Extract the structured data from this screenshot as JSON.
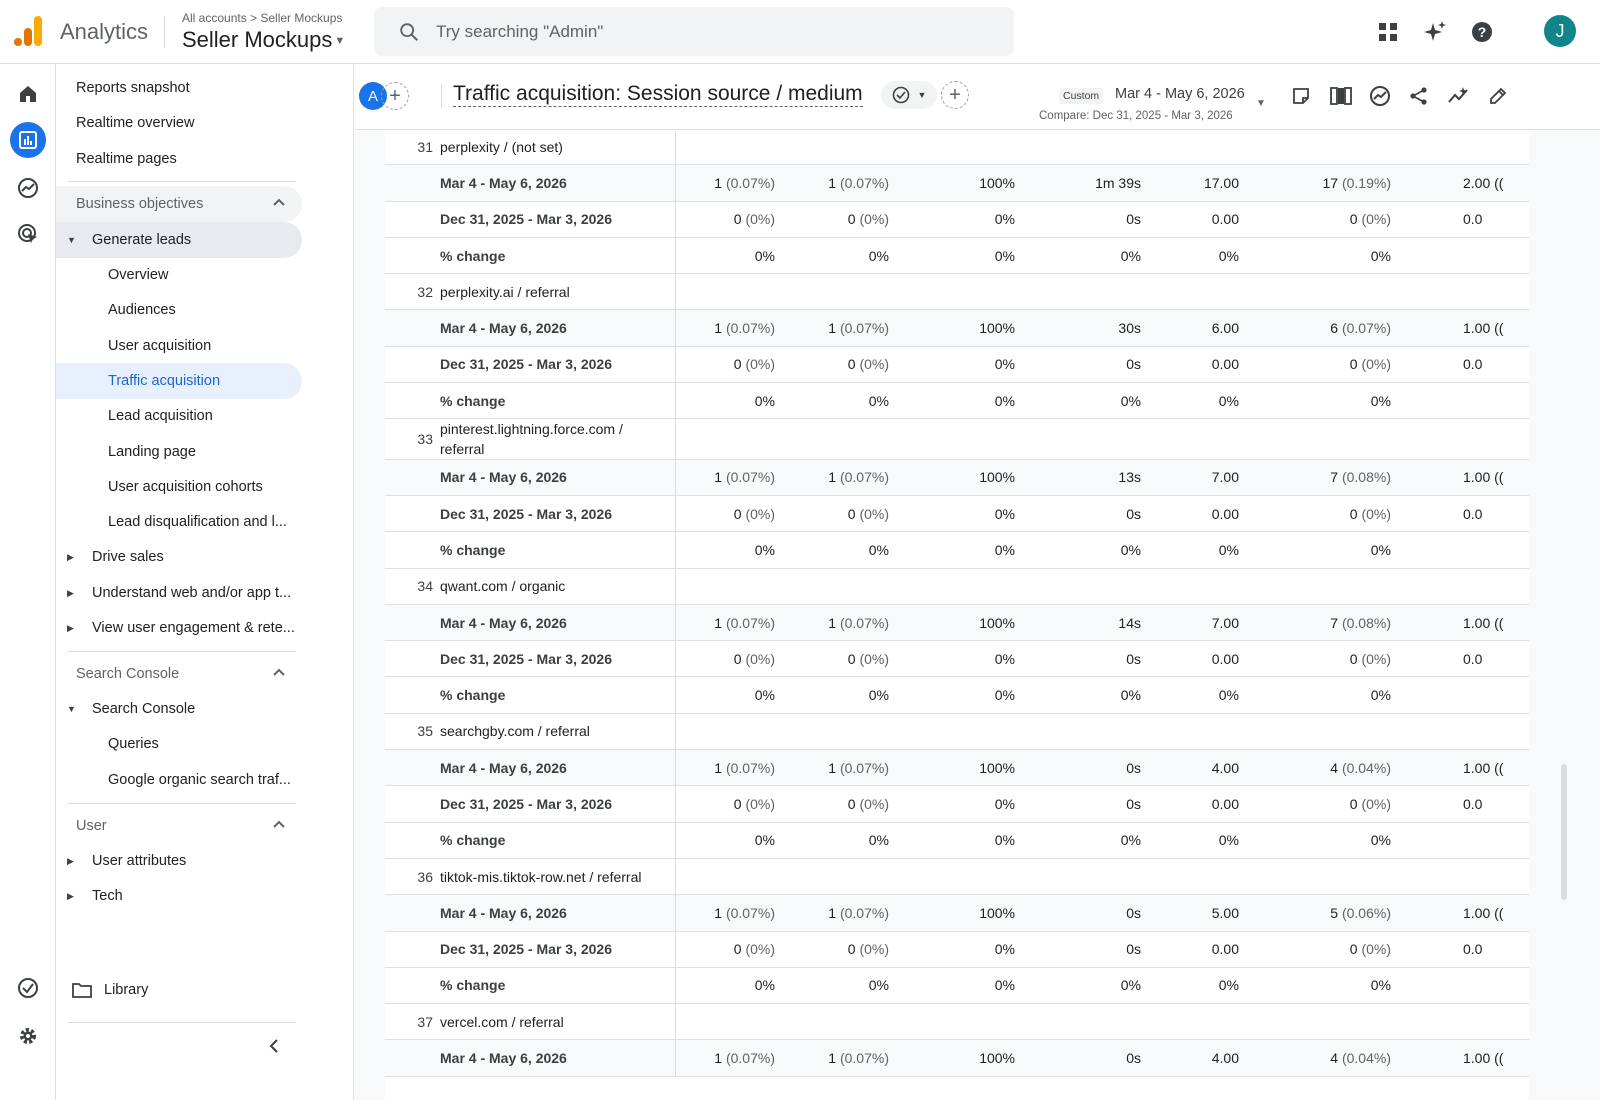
{
  "topbar": {
    "app_name": "Analytics",
    "breadcrumb": "All accounts > Seller Mockups",
    "property_name": "Seller Mockups",
    "search_placeholder": "Try searching \"Admin\"",
    "avatar_initial": "J",
    "icons": [
      "apps-grid-icon",
      "sparkle-icon",
      "help-icon"
    ]
  },
  "rail": {
    "items": [
      "home-icon",
      "reports-icon",
      "explore-icon",
      "advertising-icon"
    ],
    "bottom": [
      "check-circle-icon",
      "settings-icon"
    ]
  },
  "sidebar": {
    "reports_snapshot": "Reports snapshot",
    "realtime_overview": "Realtime overview",
    "realtime_pages": "Realtime pages",
    "business_objectives": "Business objectives",
    "generate_leads": "Generate leads",
    "overview": "Overview",
    "audiences": "Audiences",
    "user_acquisition": "User acquisition",
    "traffic_acquisition": "Traffic acquisition",
    "lead_acquisition": "Lead acquisition",
    "landing_page": "Landing page",
    "user_acquisition_cohorts": "User acquisition cohorts",
    "lead_disqualification": "Lead disqualification and l...",
    "drive_sales": "Drive sales",
    "understand_web": "Understand web and/or app t...",
    "view_user_engagement": "View user engagement & rete...",
    "search_console_section": "Search Console",
    "search_console": "Search Console",
    "queries": "Queries",
    "google_organic": "Google organic search traf...",
    "user_section": "User",
    "user_attributes": "User attributes",
    "tech": "Tech",
    "library": "Library"
  },
  "report": {
    "comparison_chip": "A",
    "title": "Traffic acquisition: Session source / medium",
    "date_badge": "Custom",
    "date_range": "Mar 4 - May 6, 2026",
    "compare_range": "Compare: Dec 31, 2025 - Mar 3, 2026"
  },
  "table": {
    "groups": [
      {
        "index": "31",
        "dimension": "perplexity / (not set)",
        "rows": [
          {
            "label": "Mar 4 - May 6, 2026",
            "v1": "1",
            "v1p": "(0.07%)",
            "v2": "1",
            "v2p": "(0.07%)",
            "v3": "100%",
            "v4": "1m 39s",
            "v5": "17.00",
            "v6": "17",
            "v6p": "(0.19%)",
            "v7": "2.00 (("
          },
          {
            "label": "Dec 31, 2025 - Mar 3, 2026",
            "v1": "0",
            "v1p": "(0%)",
            "v2": "0",
            "v2p": "(0%)",
            "v3": "0%",
            "v4": "0s",
            "v5": "0.00",
            "v6": "0",
            "v6p": "(0%)",
            "v7": "0.0"
          },
          {
            "label": "% change",
            "v1": "0%",
            "v1p": "",
            "v2": "0%",
            "v2p": "",
            "v3": "0%",
            "v4": "0%",
            "v5": "0%",
            "v6": "0%",
            "v6p": "",
            "v7": ""
          }
        ]
      },
      {
        "index": "32",
        "dimension": "perplexity.ai / referral",
        "rows": [
          {
            "label": "Mar 4 - May 6, 2026",
            "v1": "1",
            "v1p": "(0.07%)",
            "v2": "1",
            "v2p": "(0.07%)",
            "v3": "100%",
            "v4": "30s",
            "v5": "6.00",
            "v6": "6",
            "v6p": "(0.07%)",
            "v7": "1.00 (("
          },
          {
            "label": "Dec 31, 2025 - Mar 3, 2026",
            "v1": "0",
            "v1p": "(0%)",
            "v2": "0",
            "v2p": "(0%)",
            "v3": "0%",
            "v4": "0s",
            "v5": "0.00",
            "v6": "0",
            "v6p": "(0%)",
            "v7": "0.0"
          },
          {
            "label": "% change",
            "v1": "0%",
            "v1p": "",
            "v2": "0%",
            "v2p": "",
            "v3": "0%",
            "v4": "0%",
            "v5": "0%",
            "v6": "0%",
            "v6p": "",
            "v7": ""
          }
        ]
      },
      {
        "index": "33",
        "dimension": "pinterest.lightning.force.com / referral",
        "tall": true,
        "rows": [
          {
            "label": "Mar 4 - May 6, 2026",
            "v1": "1",
            "v1p": "(0.07%)",
            "v2": "1",
            "v2p": "(0.07%)",
            "v3": "100%",
            "v4": "13s",
            "v5": "7.00",
            "v6": "7",
            "v6p": "(0.08%)",
            "v7": "1.00 (("
          },
          {
            "label": "Dec 31, 2025 - Mar 3, 2026",
            "v1": "0",
            "v1p": "(0%)",
            "v2": "0",
            "v2p": "(0%)",
            "v3": "0%",
            "v4": "0s",
            "v5": "0.00",
            "v6": "0",
            "v6p": "(0%)",
            "v7": "0.0"
          },
          {
            "label": "% change",
            "v1": "0%",
            "v1p": "",
            "v2": "0%",
            "v2p": "",
            "v3": "0%",
            "v4": "0%",
            "v5": "0%",
            "v6": "0%",
            "v6p": "",
            "v7": ""
          }
        ]
      },
      {
        "index": "34",
        "dimension": "qwant.com / organic",
        "rows": [
          {
            "label": "Mar 4 - May 6, 2026",
            "v1": "1",
            "v1p": "(0.07%)",
            "v2": "1",
            "v2p": "(0.07%)",
            "v3": "100%",
            "v4": "14s",
            "v5": "7.00",
            "v6": "7",
            "v6p": "(0.08%)",
            "v7": "1.00 (("
          },
          {
            "label": "Dec 31, 2025 - Mar 3, 2026",
            "v1": "0",
            "v1p": "(0%)",
            "v2": "0",
            "v2p": "(0%)",
            "v3": "0%",
            "v4": "0s",
            "v5": "0.00",
            "v6": "0",
            "v6p": "(0%)",
            "v7": "0.0"
          },
          {
            "label": "% change",
            "v1": "0%",
            "v1p": "",
            "v2": "0%",
            "v2p": "",
            "v3": "0%",
            "v4": "0%",
            "v5": "0%",
            "v6": "0%",
            "v6p": "",
            "v7": ""
          }
        ]
      },
      {
        "index": "35",
        "dimension": "searchgby.com / referral",
        "rows": [
          {
            "label": "Mar 4 - May 6, 2026",
            "v1": "1",
            "v1p": "(0.07%)",
            "v2": "1",
            "v2p": "(0.07%)",
            "v3": "100%",
            "v4": "0s",
            "v5": "4.00",
            "v6": "4",
            "v6p": "(0.04%)",
            "v7": "1.00 (("
          },
          {
            "label": "Dec 31, 2025 - Mar 3, 2026",
            "v1": "0",
            "v1p": "(0%)",
            "v2": "0",
            "v2p": "(0%)",
            "v3": "0%",
            "v4": "0s",
            "v5": "0.00",
            "v6": "0",
            "v6p": "(0%)",
            "v7": "0.0"
          },
          {
            "label": "% change",
            "v1": "0%",
            "v1p": "",
            "v2": "0%",
            "v2p": "",
            "v3": "0%",
            "v4": "0%",
            "v5": "0%",
            "v6": "0%",
            "v6p": "",
            "v7": ""
          }
        ]
      },
      {
        "index": "36",
        "dimension": "tiktok-mis.tiktok-row.net / referral",
        "rows": [
          {
            "label": "Mar 4 - May 6, 2026",
            "v1": "1",
            "v1p": "(0.07%)",
            "v2": "1",
            "v2p": "(0.07%)",
            "v3": "100%",
            "v4": "0s",
            "v5": "5.00",
            "v6": "5",
            "v6p": "(0.06%)",
            "v7": "1.00 (("
          },
          {
            "label": "Dec 31, 2025 - Mar 3, 2026",
            "v1": "0",
            "v1p": "(0%)",
            "v2": "0",
            "v2p": "(0%)",
            "v3": "0%",
            "v4": "0s",
            "v5": "0.00",
            "v6": "0",
            "v6p": "(0%)",
            "v7": "0.0"
          },
          {
            "label": "% change",
            "v1": "0%",
            "v1p": "",
            "v2": "0%",
            "v2p": "",
            "v3": "0%",
            "v4": "0%",
            "v5": "0%",
            "v6": "0%",
            "v6p": "",
            "v7": ""
          }
        ]
      },
      {
        "index": "37",
        "dimension": "vercel.com / referral",
        "rows": [
          {
            "label": "Mar 4 - May 6, 2026",
            "v1": "1",
            "v1p": "(0.07%)",
            "v2": "1",
            "v2p": "(0.07%)",
            "v3": "100%",
            "v4": "0s",
            "v5": "4.00",
            "v6": "4",
            "v6p": "(0.04%)",
            "v7": "1.00 (("
          }
        ]
      }
    ]
  }
}
